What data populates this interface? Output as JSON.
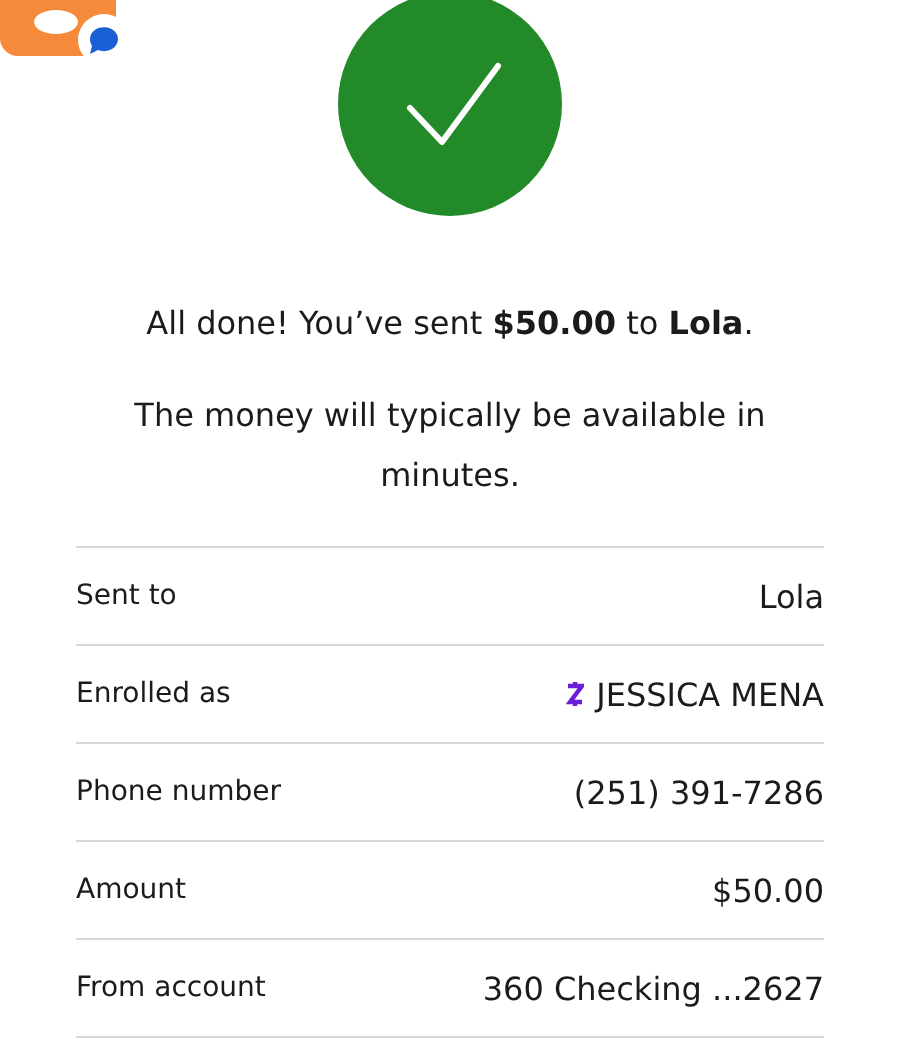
{
  "confirmation": {
    "message": "All done! You’ve sent **$50.00** to **Lola**.",
    "note": "The money will typically be available in minutes."
  },
  "details": [
    {
      "label": "Sent to",
      "value": "Lola",
      "kind": "plain"
    },
    {
      "label": "Enrolled as",
      "value": "JESSICA MENA",
      "kind": "zelle"
    },
    {
      "label": "Phone number",
      "value": "(251) 391-7286",
      "kind": "plain"
    },
    {
      "label": "Amount",
      "value": "$50.00",
      "kind": "plain"
    },
    {
      "label": "From account",
      "value": "360 Checking ...2627",
      "kind": "plain"
    }
  ]
}
